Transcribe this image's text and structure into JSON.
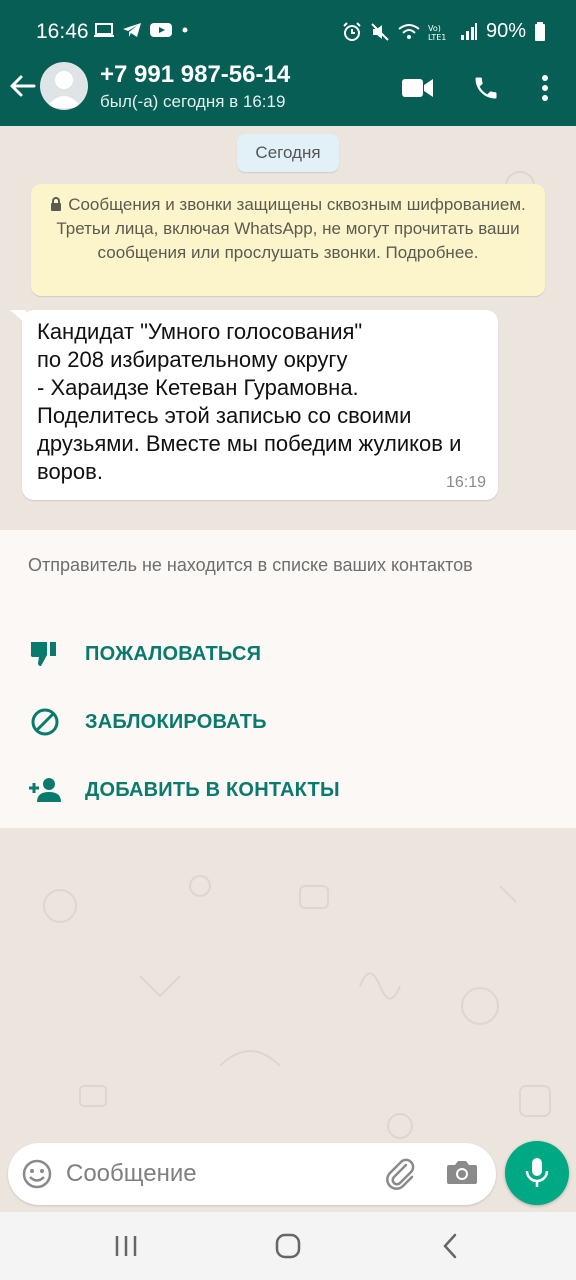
{
  "status_bar": {
    "time": "16:46",
    "battery": "90%",
    "left_icons": [
      "screen-icon",
      "telegram-icon",
      "youtube-icon",
      "dot-icon"
    ],
    "right_icons": [
      "alarm-icon",
      "mute-icon",
      "wifi-icon",
      "volte-icon",
      "signal-icon",
      "battery-icon"
    ]
  },
  "header": {
    "contact": "+7 991 987-56-14",
    "last_seen": "был(-а) сегодня в 16:19"
  },
  "chat": {
    "date_chip": "Сегодня",
    "encryption_notice": "Сообщения и звонки защищены сквозным шифрованием. Третьи лица, включая WhatsApp, не могут прочитать ваши сообщения или прослушать звонки. Подробнее.",
    "message": {
      "text": "Кандидат \"Умного голосования\"\nпо 208 избирательному округу\n- Хараидзе Кетеван Гурамовна.\nПоделитесь этой записью со своими друзьями. Вместе мы победим жуликов и воров.",
      "time": "16:19"
    }
  },
  "unknown_sender": {
    "notice": "Отправитель не находится в списке ваших контактов",
    "actions": [
      {
        "label": "ПОЖАЛОВАТЬСЯ",
        "icon": "thumb-down-icon"
      },
      {
        "label": "ЗАБЛОКИРОВАТЬ",
        "icon": "block-icon"
      },
      {
        "label": "ДОБАВИТЬ В КОНТАКТЫ",
        "icon": "add-person-icon"
      }
    ]
  },
  "composer": {
    "placeholder": "Сообщение",
    "value": ""
  },
  "colors": {
    "header_bg": "#075e54",
    "accent": "#00a884",
    "action_text": "#0a7a6c",
    "chat_bg": "#ece5dd",
    "encryption_bg": "#fcf4cb"
  }
}
